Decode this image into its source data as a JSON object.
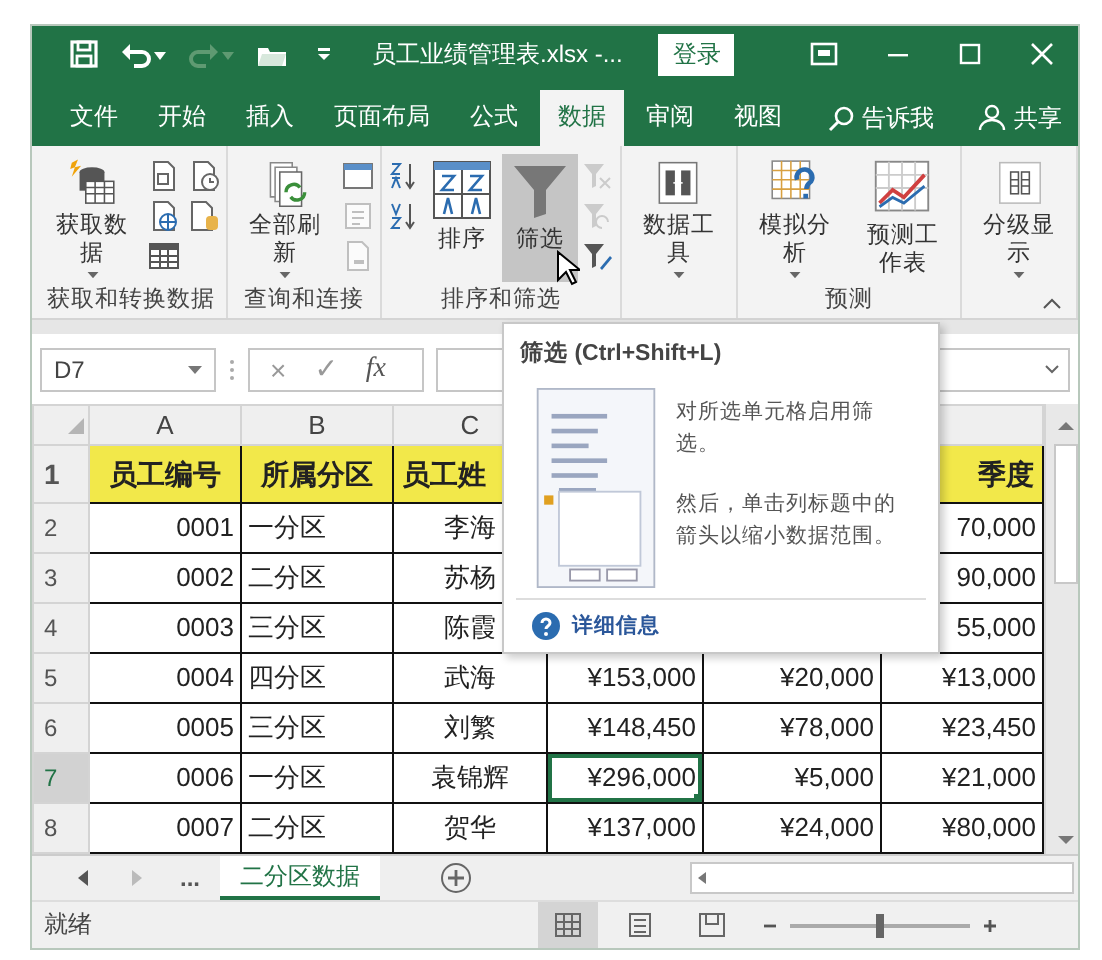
{
  "title_bar": {
    "quick_access": [
      {
        "disabled": false,
        "dropdown": false
      },
      {
        "disabled": false,
        "dropdown": true
      },
      {
        "disabled": true,
        "dropdown": true
      },
      {
        "disabled": false,
        "dropdown": false
      },
      {
        "disabled": false,
        "dropdown": false
      }
    ],
    "title": "员工业绩管理表.xlsx -...",
    "sign_in": "登录"
  },
  "ribbon_tabs": [
    {
      "label": "文件",
      "selected": false
    },
    {
      "label": "开始",
      "selected": false
    },
    {
      "label": "插入",
      "selected": false
    },
    {
      "label": "页面布局",
      "selected": false
    },
    {
      "label": "公式",
      "selected": false
    },
    {
      "label": "数据",
      "selected": true
    },
    {
      "label": "审阅",
      "selected": false
    },
    {
      "label": "视图",
      "selected": false
    }
  ],
  "tell_me": "告诉我",
  "share": "共享",
  "ribbon_groups": [
    {
      "label": "获取和转换数据",
      "commands": [
        {
          "kind": "large",
          "label": "获取数据",
          "dropdown": true,
          "highlighted": false,
          "disabled": false
        },
        {
          "kind": "small",
          "disabled": false
        },
        {
          "kind": "small",
          "disabled": false
        },
        {
          "kind": "small",
          "disabled": false
        },
        {
          "kind": "small",
          "disabled": false
        },
        {
          "kind": "small",
          "disabled": false
        }
      ]
    },
    {
      "label": "查询和连接",
      "commands": [
        {
          "kind": "large",
          "label": "全部刷新",
          "dropdown": true,
          "highlighted": false,
          "disabled": false
        },
        {
          "kind": "small",
          "disabled": false
        },
        {
          "kind": "small",
          "disabled": true
        },
        {
          "kind": "small",
          "disabled": true
        }
      ]
    },
    {
      "label": "排序和筛选",
      "commands": [
        {
          "kind": "small",
          "disabled": false
        },
        {
          "kind": "small",
          "disabled": false
        },
        {
          "kind": "large",
          "label": "排序",
          "dropdown": false,
          "highlighted": false,
          "disabled": false
        },
        {
          "kind": "large",
          "label": "筛选",
          "dropdown": false,
          "highlighted": true,
          "disabled": false
        },
        {
          "kind": "small",
          "disabled": true
        },
        {
          "kind": "small",
          "disabled": true
        },
        {
          "kind": "small",
          "disabled": false
        }
      ]
    },
    {
      "commands": [
        {
          "kind": "large",
          "label": "数据工具",
          "dropdown": true,
          "highlighted": false,
          "disabled": false
        }
      ]
    },
    {
      "label": "预测",
      "commands": [
        {
          "kind": "large",
          "label": "模拟分析",
          "dropdown": true,
          "highlighted": false,
          "disabled": false
        },
        {
          "kind": "large",
          "label": "预测工作表",
          "dropdown": false,
          "highlighted": false,
          "disabled": false
        }
      ]
    },
    {
      "commands": [
        {
          "kind": "large",
          "label": "分级显示",
          "dropdown": true,
          "highlighted": false,
          "disabled": false
        }
      ]
    }
  ],
  "formula_bar": {
    "name_box": "D7",
    "cancel": "×",
    "enter": "✓",
    "function": "fx"
  },
  "sheet": {
    "column_headers": [
      "A",
      "B",
      "C"
    ],
    "rows": [
      {
        "number": "1",
        "selected": false,
        "cells": [
          {
            "text": "员工编号",
            "selected": false
          },
          {
            "text": "所属分区",
            "selected": false
          },
          {
            "text": "员工姓",
            "selected": false
          },
          null,
          null,
          {
            "text": "季度",
            "selected": false
          }
        ]
      },
      {
        "number": "2",
        "selected": false,
        "cells": [
          {
            "text": "0001",
            "selected": false
          },
          {
            "text": "一分区",
            "selected": false
          },
          {
            "text": "李海",
            "selected": false
          },
          null,
          null,
          {
            "text": "70,000",
            "selected": false
          }
        ]
      },
      {
        "number": "3",
        "selected": false,
        "cells": [
          {
            "text": "0002",
            "selected": false
          },
          {
            "text": "二分区",
            "selected": false
          },
          {
            "text": "苏杨",
            "selected": false
          },
          null,
          null,
          {
            "text": "90,000",
            "selected": false
          }
        ]
      },
      {
        "number": "4",
        "selected": false,
        "cells": [
          {
            "text": "0003",
            "selected": false
          },
          {
            "text": "三分区",
            "selected": false
          },
          {
            "text": "陈霞",
            "selected": false
          },
          null,
          null,
          {
            "text": "55,000",
            "selected": false
          }
        ]
      },
      {
        "number": "5",
        "selected": false,
        "cells": [
          {
            "text": "0004",
            "selected": false
          },
          {
            "text": "四分区",
            "selected": false
          },
          {
            "text": "武海",
            "selected": false
          },
          {
            "text": "¥153,000",
            "selected": false
          },
          {
            "text": "¥20,000",
            "selected": false
          },
          {
            "text": "¥13,000",
            "selected": false
          }
        ]
      },
      {
        "number": "6",
        "selected": false,
        "cells": [
          {
            "text": "0005",
            "selected": false
          },
          {
            "text": "三分区",
            "selected": false
          },
          {
            "text": "刘繁",
            "selected": false
          },
          {
            "text": "¥148,450",
            "selected": false
          },
          {
            "text": "¥78,000",
            "selected": false
          },
          {
            "text": "¥23,450",
            "selected": false
          }
        ]
      },
      {
        "number": "7",
        "selected": true,
        "cells": [
          {
            "text": "0006",
            "selected": false
          },
          {
            "text": "一分区",
            "selected": false
          },
          {
            "text": "袁锦辉",
            "selected": false
          },
          {
            "text": "¥296,000",
            "selected": true
          },
          {
            "text": "¥5,000",
            "selected": false
          },
          {
            "text": "¥21,000",
            "selected": false
          }
        ]
      },
      {
        "number": "8",
        "selected": false,
        "cells": [
          {
            "text": "0007",
            "selected": false
          },
          {
            "text": "二分区",
            "selected": false
          },
          {
            "text": "贺华",
            "selected": false
          },
          {
            "text": "¥137,000",
            "selected": false
          },
          {
            "text": "¥24,000",
            "selected": false
          },
          {
            "text": "¥80,000",
            "selected": false
          }
        ]
      }
    ]
  },
  "tooltip": {
    "title": "筛选 (Ctrl+Shift+L)",
    "paragraphs": [
      "对所选单元格启用筛选。",
      "然后，单击列标题中的箭头以缩小数据范围。"
    ],
    "link": "详细信息"
  },
  "sheet_tabs": {
    "more": "...",
    "tabs": [
      {
        "label": "二分区数据",
        "selected": true
      }
    ]
  },
  "status_bar": {
    "status": "就绪",
    "views": [
      {
        "selected": true
      },
      {
        "selected": false
      },
      {
        "selected": false
      }
    ],
    "zoom": {
      "level": 0.5
    }
  }
}
